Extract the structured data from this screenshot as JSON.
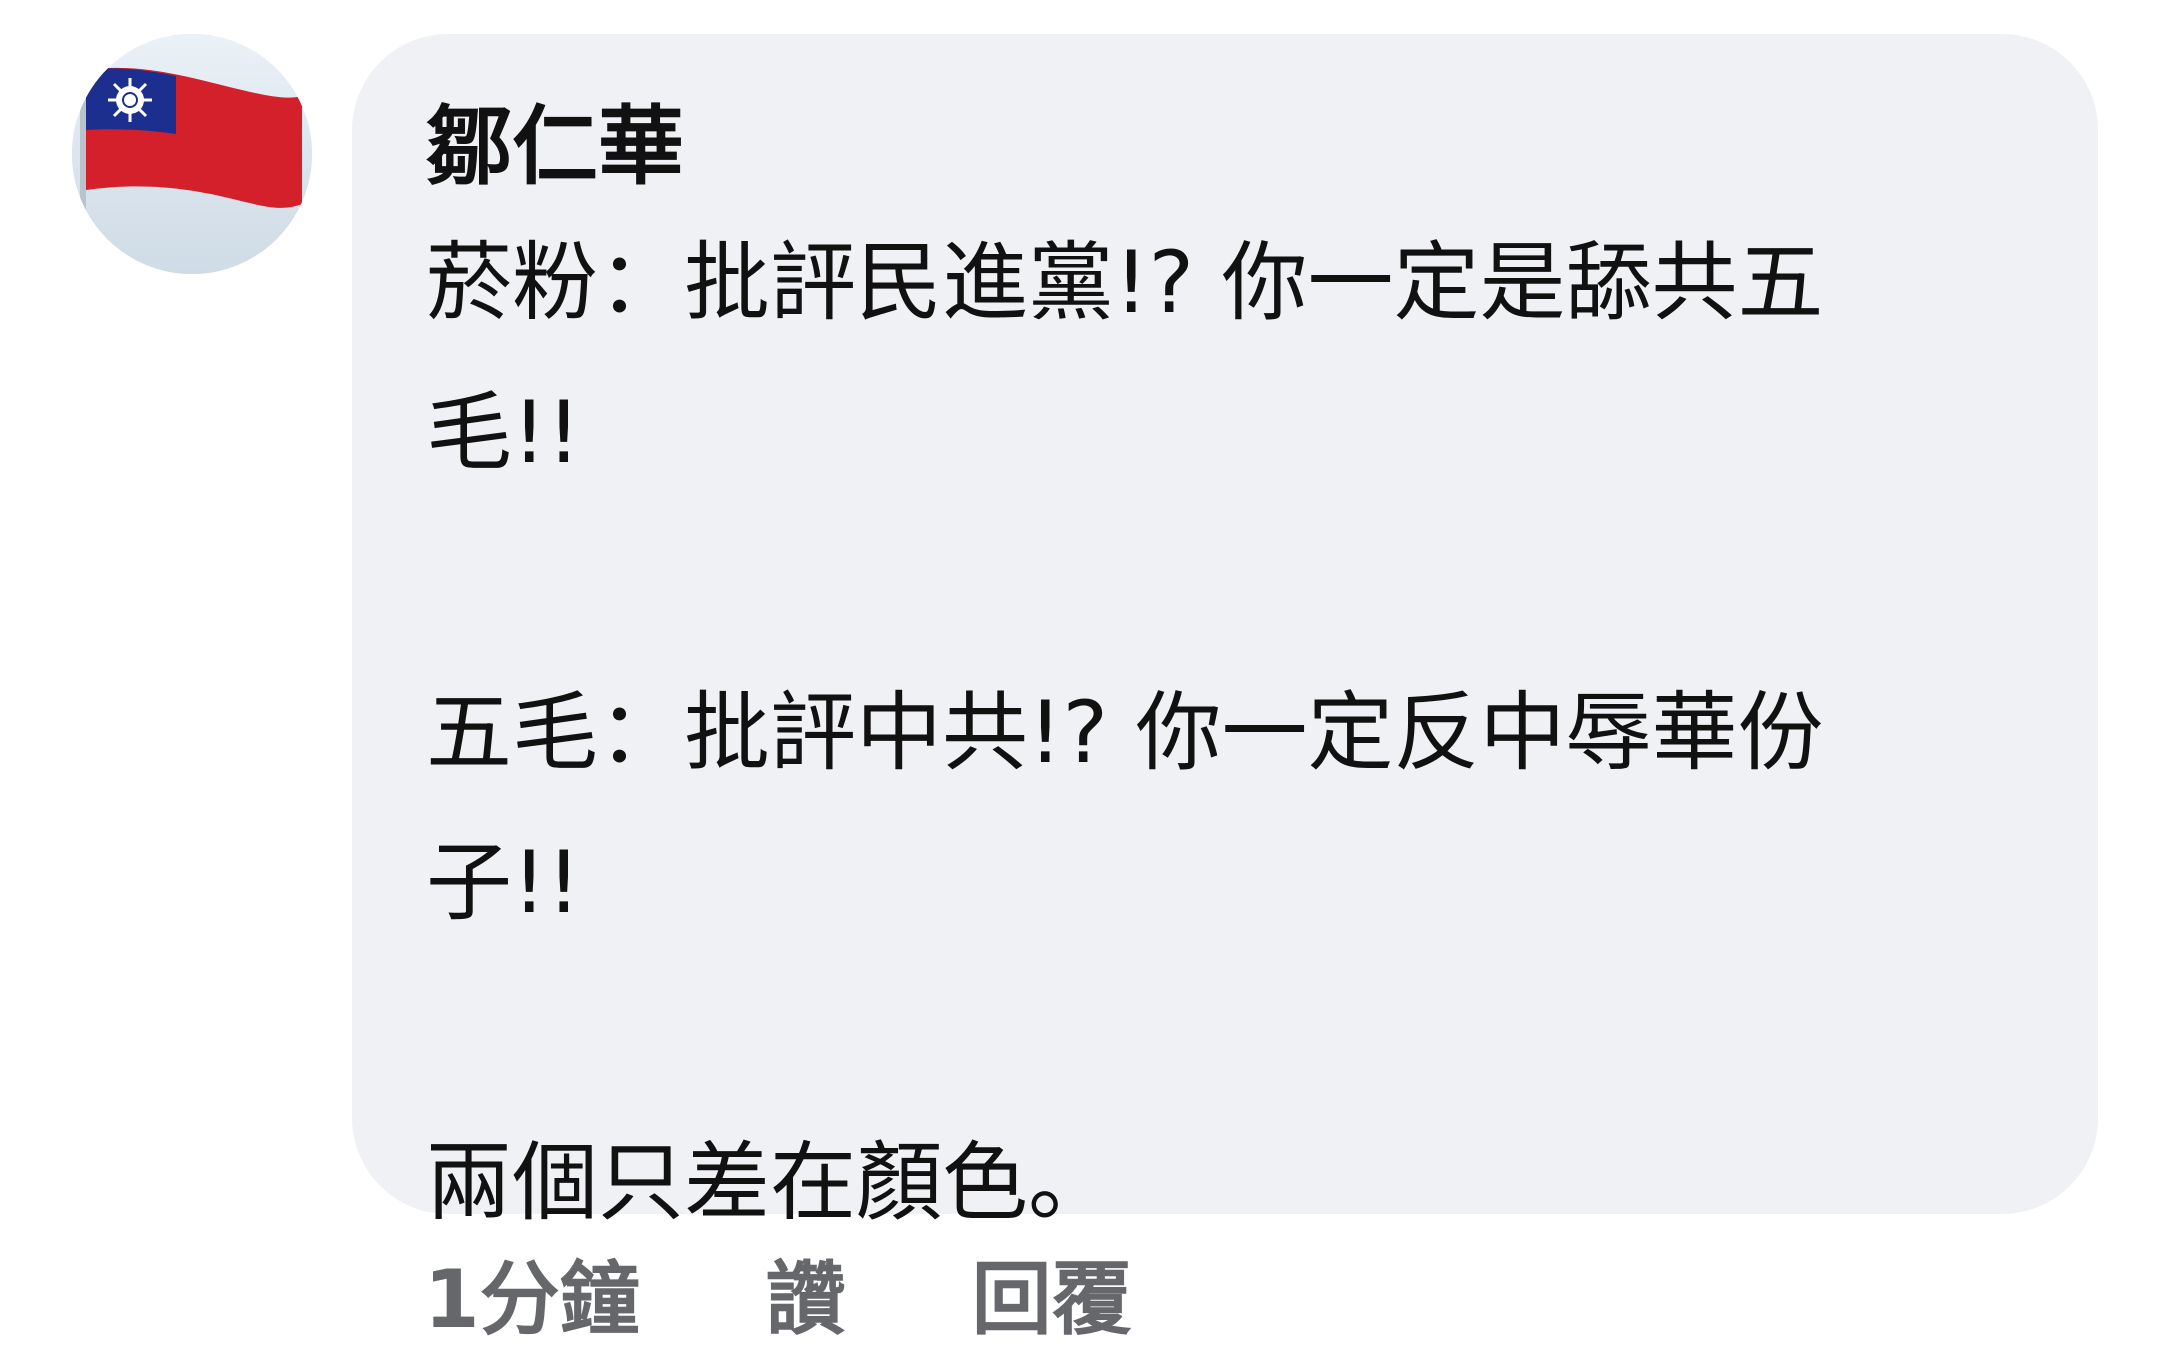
{
  "comment": {
    "author": "鄒仁華",
    "lines": [
      "菸粉：批評民進黨!? 你一定是舔共五",
      "毛!!",
      "",
      "五毛：批評中共!? 你一定反中辱華份",
      "子!!",
      "",
      "兩個只差在顏色。"
    ],
    "avatar_icon": "taiwan-flag-icon"
  },
  "actions": {
    "time": "1分鐘",
    "like": "讚",
    "reply": "回覆"
  },
  "colors": {
    "bubble": "#f0f1f5",
    "text": "#111111",
    "meta": "#65676b"
  }
}
